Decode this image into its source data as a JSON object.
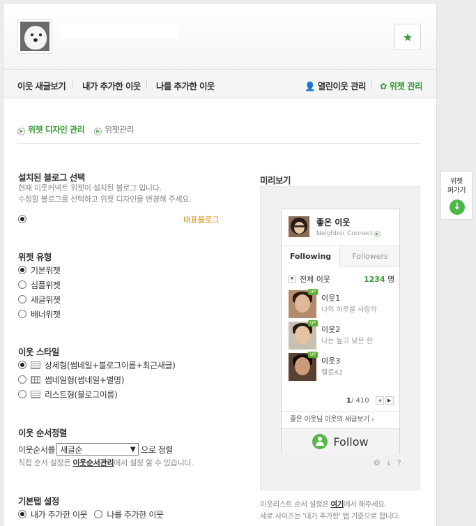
{
  "header": {
    "star_icon": "star-icon"
  },
  "nav": {
    "tabs": [
      "이웃 새글보기",
      "내가 추가한 이웃",
      "나를 추가한 이웃"
    ],
    "open_neighbor_label": "열린이웃 관리",
    "widget_manage_label": "위젯 관리",
    "accent": "#3a9a3a"
  },
  "subtabs": {
    "design": "위젯 디자인 관리",
    "manage": "위젯관리"
  },
  "blog_section": {
    "title": "설치된 블로그 선택",
    "desc1": "현재 이웃커넥트 위젯이 설치된 블로그 입니다.",
    "desc2": "수정할 블로그를 선택하고 위젯 디자인을 변경해 주세요.",
    "rep_label": "대표블로그"
  },
  "widget_type": {
    "title": "위젯 유형",
    "options": [
      "기본위젯",
      "심플위젯",
      "새글위젯",
      "배너위젯"
    ],
    "selected_index": 0
  },
  "neighbor_style": {
    "title": "이웃 스타일",
    "options": [
      "상세형(썸네일+블로그이름+최근새글)",
      "썸네일형(썸네일+별명)",
      "리스트형(블로그이름)"
    ],
    "selected_index": 0
  },
  "sort": {
    "title": "이웃 순서정렬",
    "prefix": "이웃순서를",
    "selected": "새글순",
    "suffix": "으로 정렬",
    "note_prefix": "직접 순서 설정은",
    "note_link": "이웃순서관리",
    "note_suffix": "에서 설정 할 수 있습니다."
  },
  "default_tab": {
    "title": "기본탭 설정",
    "options": [
      "내가 추가한 이웃",
      "나를 추가한 이웃"
    ],
    "selected_index": 0
  },
  "preview": {
    "label": "미리보기",
    "name": "좋은 이웃",
    "sub": "Neighbor Connect",
    "tab_following": "Following",
    "tab_followers": "Followers",
    "total_label": "전체 이웃",
    "total_count": "1234",
    "total_unit": "명",
    "neighbors": [
      {
        "name": "이웃1",
        "text": "나의 하루를 사랑하",
        "badge": "UP"
      },
      {
        "name": "이웃2",
        "text": "나는 높고 낮은 한",
        "badge": "UP"
      },
      {
        "name": "이웃3",
        "text": "헬로42",
        "badge": "UP"
      }
    ],
    "page_current": "1",
    "page_total": "/ 410",
    "footer": "좋은 이웃님 이웃의 새글보기",
    "follow_label": "Follow",
    "tools": "⚙ ⤓ ?"
  },
  "bottom_note": {
    "line1_prefix": "이웃리스트 순서 설정은",
    "line1_link": "여기",
    "line1_suffix": "에서 해주세요.",
    "line2": "세로 사이즈는 '내가 추가한' 탭 기준으로 합니다."
  },
  "side_widget": {
    "line1": "위젯",
    "line2": "퍼가기"
  }
}
